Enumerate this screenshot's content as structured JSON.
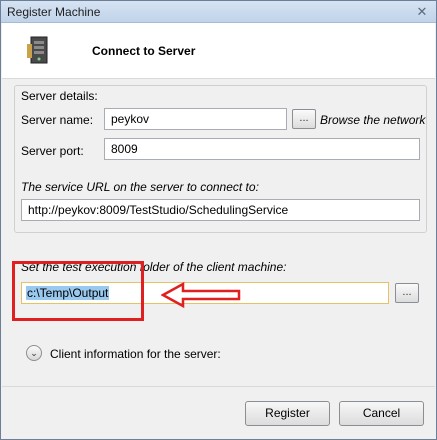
{
  "window": {
    "title": "Register Machine",
    "close_glyph": "✕"
  },
  "header": {
    "title": "Connect to Server",
    "icon": "server-icon"
  },
  "details": {
    "group_label": "Server details:",
    "server_name_label": "Server name:",
    "server_name_value": "peykov",
    "browse_button_label": "...",
    "browse_network_label": "Browse the network",
    "server_port_label": "Server port:",
    "server_port_value": "8009",
    "service_url_label": "The service URL on the server to connect to:",
    "service_url_value": "http://peykov:8009/TestStudio/SchedulingService"
  },
  "execution": {
    "folder_label": "Set the test execution folder of the client machine:",
    "folder_value": "c:\\Temp\\Output",
    "folder_browse_label": "..."
  },
  "client_info": {
    "expander_glyph": "⌄",
    "label": "Client information for the server:"
  },
  "footer": {
    "register_label": "Register",
    "cancel_label": "Cancel"
  },
  "colors": {
    "annotation_red": "#e02020",
    "selection": "#99c9ef"
  }
}
